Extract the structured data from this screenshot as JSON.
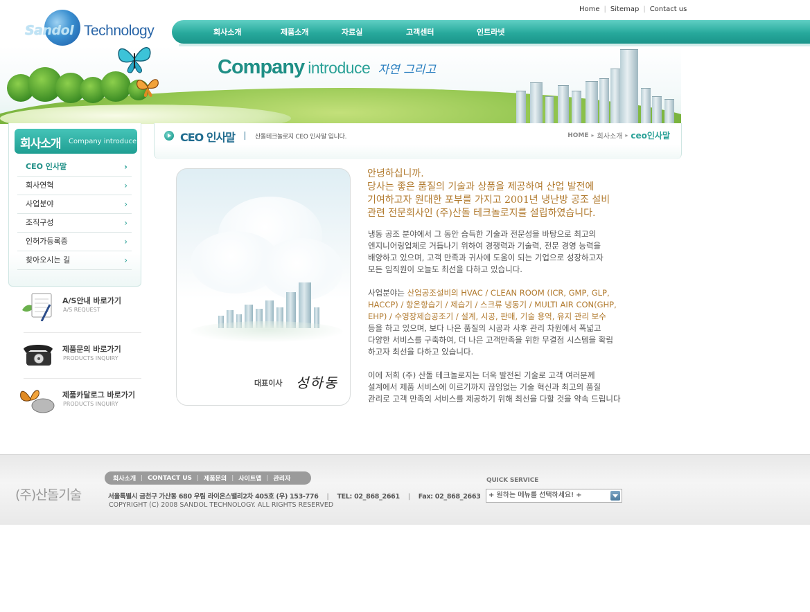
{
  "util_links": [
    "Home",
    "Sitemap",
    "Contact us"
  ],
  "logo": {
    "brand1": "Sandol",
    "brand2": "Technology"
  },
  "gnb": [
    "회사소개",
    "제품소개",
    "자료실",
    "고객센터",
    "인트라넷"
  ],
  "banner": {
    "title1": "Company",
    "title2": "introduce",
    "title3": "자연 그리고"
  },
  "lnb": {
    "title_ko": "회사소개",
    "title_en": "Company introduce",
    "items": [
      "CEO 인사말",
      "회사연혁",
      "사업분야",
      "조직구성",
      "인허가등록증",
      "찾아오시는 길"
    ],
    "active_index": 0
  },
  "quick_links": [
    {
      "title": "A/S안내 바로가기",
      "sub": "A/S REQUEST",
      "icon": "notepad-icon"
    },
    {
      "title": "제품문의 바로가기",
      "sub": "PRODUCTS INQUIRY",
      "icon": "telephone-icon"
    },
    {
      "title": "제품카달로그 바로가기",
      "sub": "PRODUCTS INQUIRY",
      "icon": "butterfly-mouse-icon"
    }
  ],
  "page_title": {
    "title": "CEO 인사말",
    "desc": "산돌테크놀로지 CEO 인사말 입니다.",
    "breadcrumb": [
      "HOME",
      "회사소개",
      "ceo인사말"
    ]
  },
  "ceo": {
    "label": "대표이사",
    "signature": "성하동"
  },
  "greeting": [
    "안녕하십니까.",
    "당사는 좋은 품질의 기술과 상품을  제공하여 산업 발전에",
    "기여하고자 원대한 포부를 가지고 2001년 냉난방 공조 설비",
    "관련 전문회사인 (주)산돌 테크놀로지를 설립하였습니다."
  ],
  "paragraph1": [
    "냉동 공조 분야에서 그 동안 습득한 기술과 전문성을 바탕으로 최고의",
    "엔지니어링업체로 거듭나기 위하여 경쟁력과 기술력, 전문 경영 능력을",
    "배양하고 있으며, 고객 만족과  귀사에 도움이  되는 기업으로 성장하고자",
    "모든 임직원이 오늘도 최선을 다하고 있습니다."
  ],
  "paragraph2": {
    "prefix": "사업분야는 ",
    "hl1": "산업공조설비의 HVAC / CLEAN ROOM  (ICR, GMP, GLP,",
    "hl2": "HACCP)  /  항온항습기 / 제습기 / 스크류 냉동기 / MULTI AIR CON(GHP,",
    "hl3": "EHP) / 수영장제습공조기 / 설계, 시공, 판매, 기술 용역, 유지 관리 보수",
    "rest": [
      "등을 하고 있으며, 보다 나은 품질의 시공과 사후 관리 차원에서 폭넓고",
      "다양한 서비스를 구축하여, 더 나은 고객만족을 위한 무결점 시스템을 확립",
      "하고자 최선을  다하고 있습니다."
    ]
  },
  "paragraph3": [
    "이에 저희 (주) 산돌 테크놀로지는 더욱 발전된 기술로 고객 여러분께",
    "설계에서 제품 서비스에 이르기까지 끊임없는 기술 혁신과 최고의 품질",
    "관리로 고객 만족의 서비스를 제공하기 위해 최선을 다할 것을 약속 드립니다"
  ],
  "footer": {
    "logo": "(주)산돌기술",
    "nav": [
      "회사소개",
      "CONTACT US",
      "제품문의",
      "사이트맵",
      "관리자"
    ],
    "address": "서울특별시 금천구 가산동 680 우림 라이온스밸리2차 405호 (우) 153-776",
    "tel": "TEL: 02_868_2661",
    "fax": "Fax: 02_868_2663",
    "copyright": "COPYRIGHT (C) 2008 SANDOL TECHNOLOGY.  ALL RIGHTS RESERVED",
    "quick_service_label": "QUICK SERVICE",
    "quick_service_value": "+ 원하는 메뉴를 선택하세요! +"
  },
  "colors": {
    "accent": "#1f9e92",
    "gold_text": "#b17a2e",
    "title_blue": "#1f6b8e"
  }
}
